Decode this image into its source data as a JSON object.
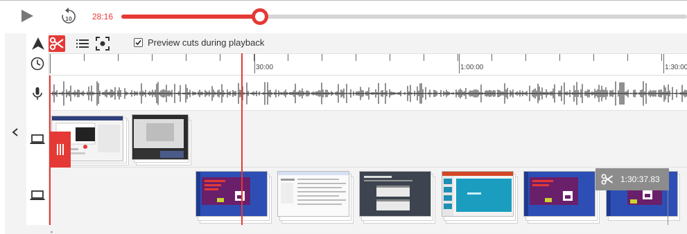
{
  "player": {
    "current_time": "28:16",
    "progress": 0.245,
    "play_icon": "play-icon",
    "replay_icon": "replay-10-icon",
    "replay_label": "10"
  },
  "toolbar": {
    "tools": [
      "select-arrow-icon",
      "scissors-icon",
      "list-icon",
      "focus-icon"
    ],
    "active_tool": "scissors-icon",
    "preview_cuts_label": "Preview cuts during playback",
    "preview_cuts_checked": true
  },
  "ruler": {
    "labels": [
      "30:00",
      "1:00:00",
      "1:30:00"
    ]
  },
  "cut_marker": {
    "time": "1:30:37.83"
  },
  "colors": {
    "accent": "#e53935",
    "track_bg": "#f3f3f3",
    "tooltip_bg": "#8c8c8c",
    "slide_blue": "#2d4fb5",
    "slide_purple": "#6a1f6a"
  }
}
